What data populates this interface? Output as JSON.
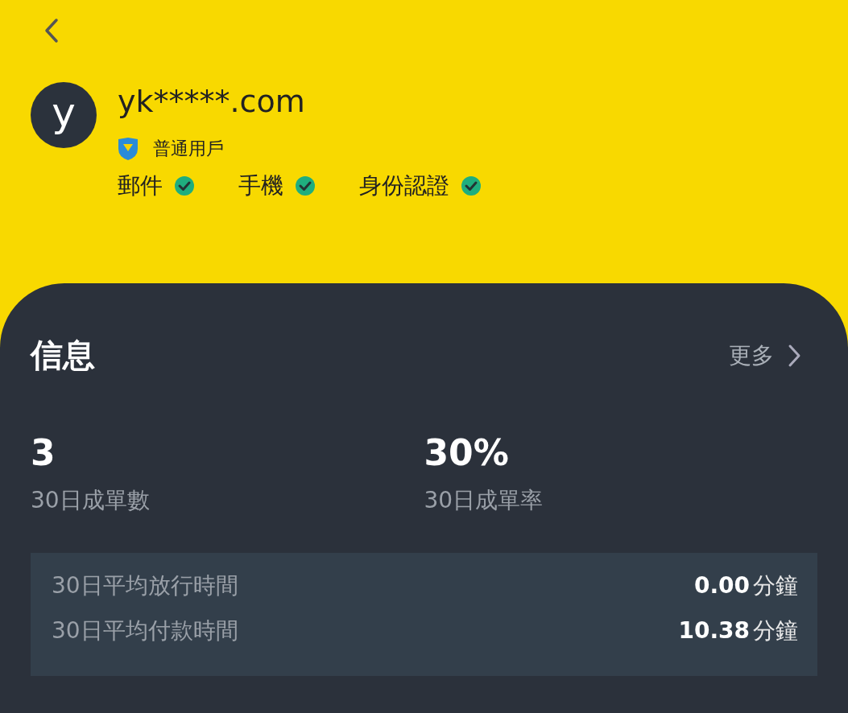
{
  "profile": {
    "avatar_letter": "y",
    "name": "yk*****.com",
    "level": "普通用戶",
    "verifications": [
      {
        "label": "郵件",
        "verified": true
      },
      {
        "label": "手機",
        "verified": true
      },
      {
        "label": "身份認證",
        "verified": true
      }
    ]
  },
  "info": {
    "title": "信息",
    "more": "更多",
    "stats": [
      {
        "value": "3",
        "label": "30日成單數"
      },
      {
        "value": "30%",
        "label": "30日成單率"
      }
    ],
    "details": [
      {
        "label": "30日平均放行時間",
        "value": "0.00",
        "unit": "分鐘"
      },
      {
        "label": "30日平均付款時間",
        "value": "10.38",
        "unit": "分鐘"
      }
    ]
  }
}
